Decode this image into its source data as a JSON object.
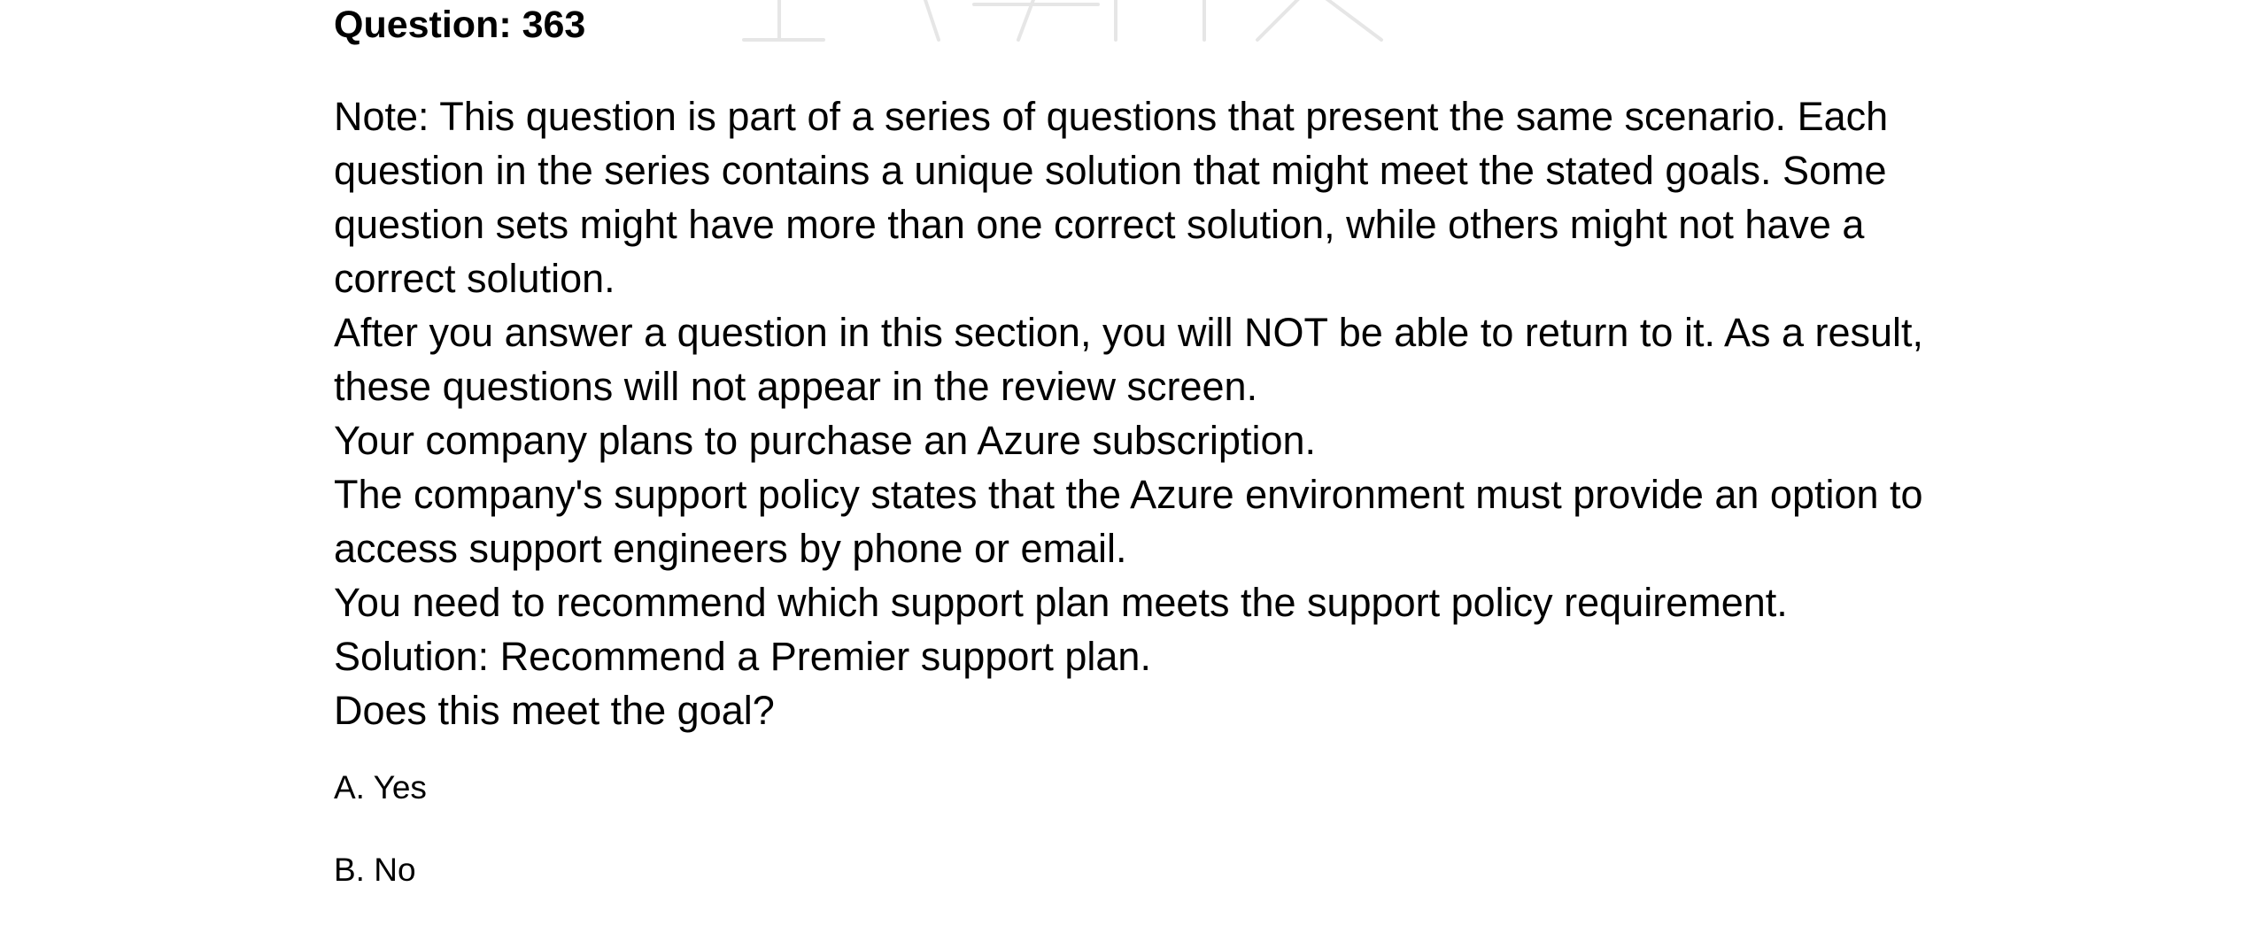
{
  "question": {
    "title": "Question: 363"
  },
  "paragraphs": [
    "Note: This question is part of a series of questions that present the same scenario. Each question in the series contains a unique solution that might meet the stated goals. Some question sets might have more than one correct solution, while others might not have a correct solution.",
    "After you answer a question in this section, you will NOT be able to return to it. As a result, these questions will not appear in the review screen.",
    "Your company plans to purchase an Azure subscription.",
    "The company's support policy states that the Azure environment must provide an option to access support engineers by phone or email.",
    "You need to recommend which support plan meets the support policy requirement.",
    "Solution: Recommend a Premier support plan.",
    "Does this meet the goal?"
  ],
  "options": [
    "A. Yes",
    "B. No"
  ],
  "colors": {
    "text": "#000000",
    "watermark": "#e6e6e6",
    "background": "#ffffff"
  }
}
